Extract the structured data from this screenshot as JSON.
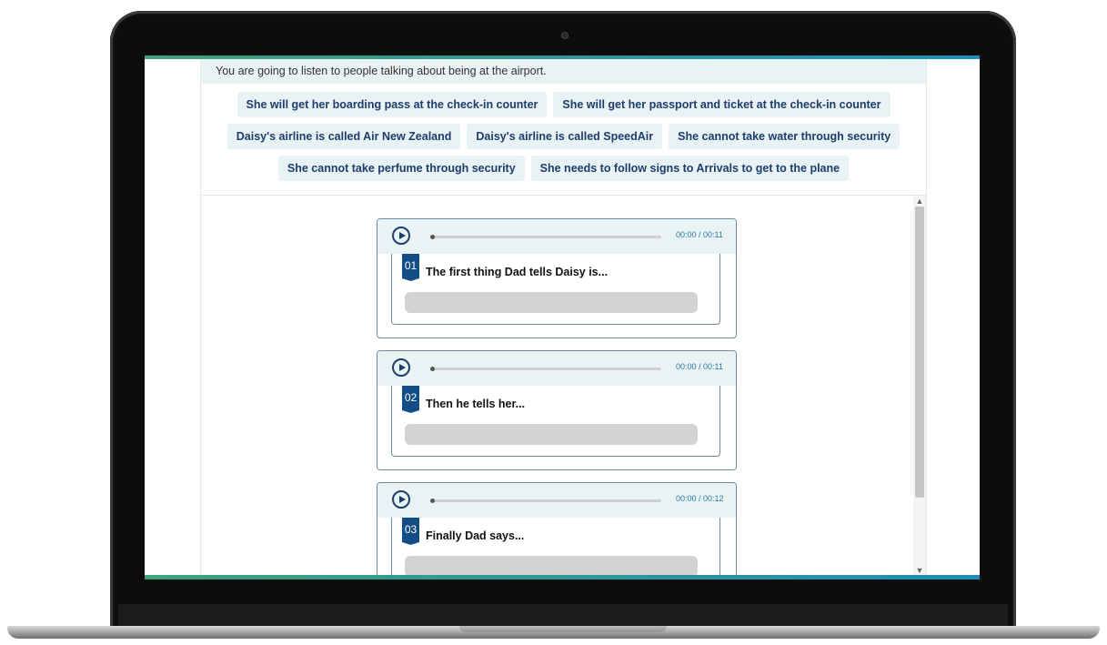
{
  "instruction": "You are going to listen to people talking about being at the airport.",
  "answer_chips": {
    "row1": [
      "She will get her boarding pass at the check-in counter",
      "She will get her passport and ticket at the check-in counter"
    ],
    "row2": [
      "Daisy's airline is called Air New Zealand",
      "Daisy's airline is called SpeedAir",
      "She cannot take water through security"
    ],
    "row3": [
      "She cannot take perfume through security",
      "She needs to follow signs to Arrivals to get to the plane"
    ]
  },
  "questions": [
    {
      "number": "01",
      "text": "The first thing Dad tells Daisy is...",
      "time": "00:00 / 00:11"
    },
    {
      "number": "02",
      "text": "Then he tells her...",
      "time": "00:00 / 00:11"
    },
    {
      "number": "03",
      "text": "Finally Dad says...",
      "time": "00:00 / 00:12"
    }
  ],
  "icons": {
    "play": "play-icon",
    "scroll_up": "chevron-up-icon",
    "scroll_down": "chevron-down-icon"
  },
  "colors": {
    "accent_navy": "#1d3d6b",
    "number_badge": "#134d86",
    "chip_bg": "#e9f2f4",
    "time_text": "#2a7aa6",
    "bar_gradient_start": "#3ea27c",
    "bar_gradient_end": "#1f8fb6"
  }
}
